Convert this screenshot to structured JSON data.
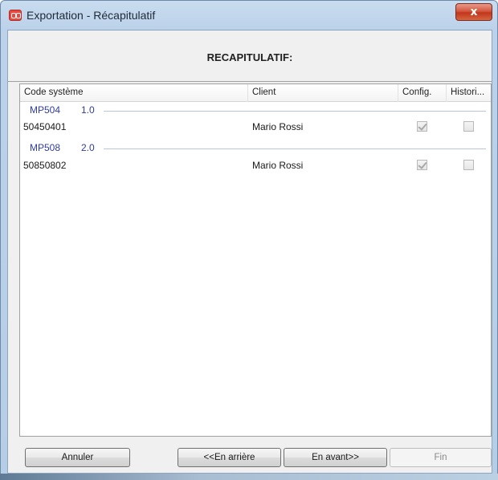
{
  "window": {
    "title": "Exportation - Récapitulatif",
    "close_label": "x"
  },
  "header": {
    "title": "RECAPITULATIF:"
  },
  "list": {
    "columns": [
      "Code système",
      "Client",
      "Config.",
      "Histori..."
    ],
    "groups": [
      {
        "name": "MP504",
        "version": "1.0",
        "rows": [
          {
            "code": "50450401",
            "client": "Mario Rossi",
            "config": true,
            "historique": false
          }
        ]
      },
      {
        "name": "MP508",
        "version": "2.0",
        "rows": [
          {
            "code": "50850802",
            "client": "Mario Rossi",
            "config": true,
            "historique": false
          }
        ]
      }
    ]
  },
  "buttons": {
    "cancel": "Annuler",
    "back": "<<En arrière",
    "next": "En avant>>",
    "finish": "Fin"
  }
}
